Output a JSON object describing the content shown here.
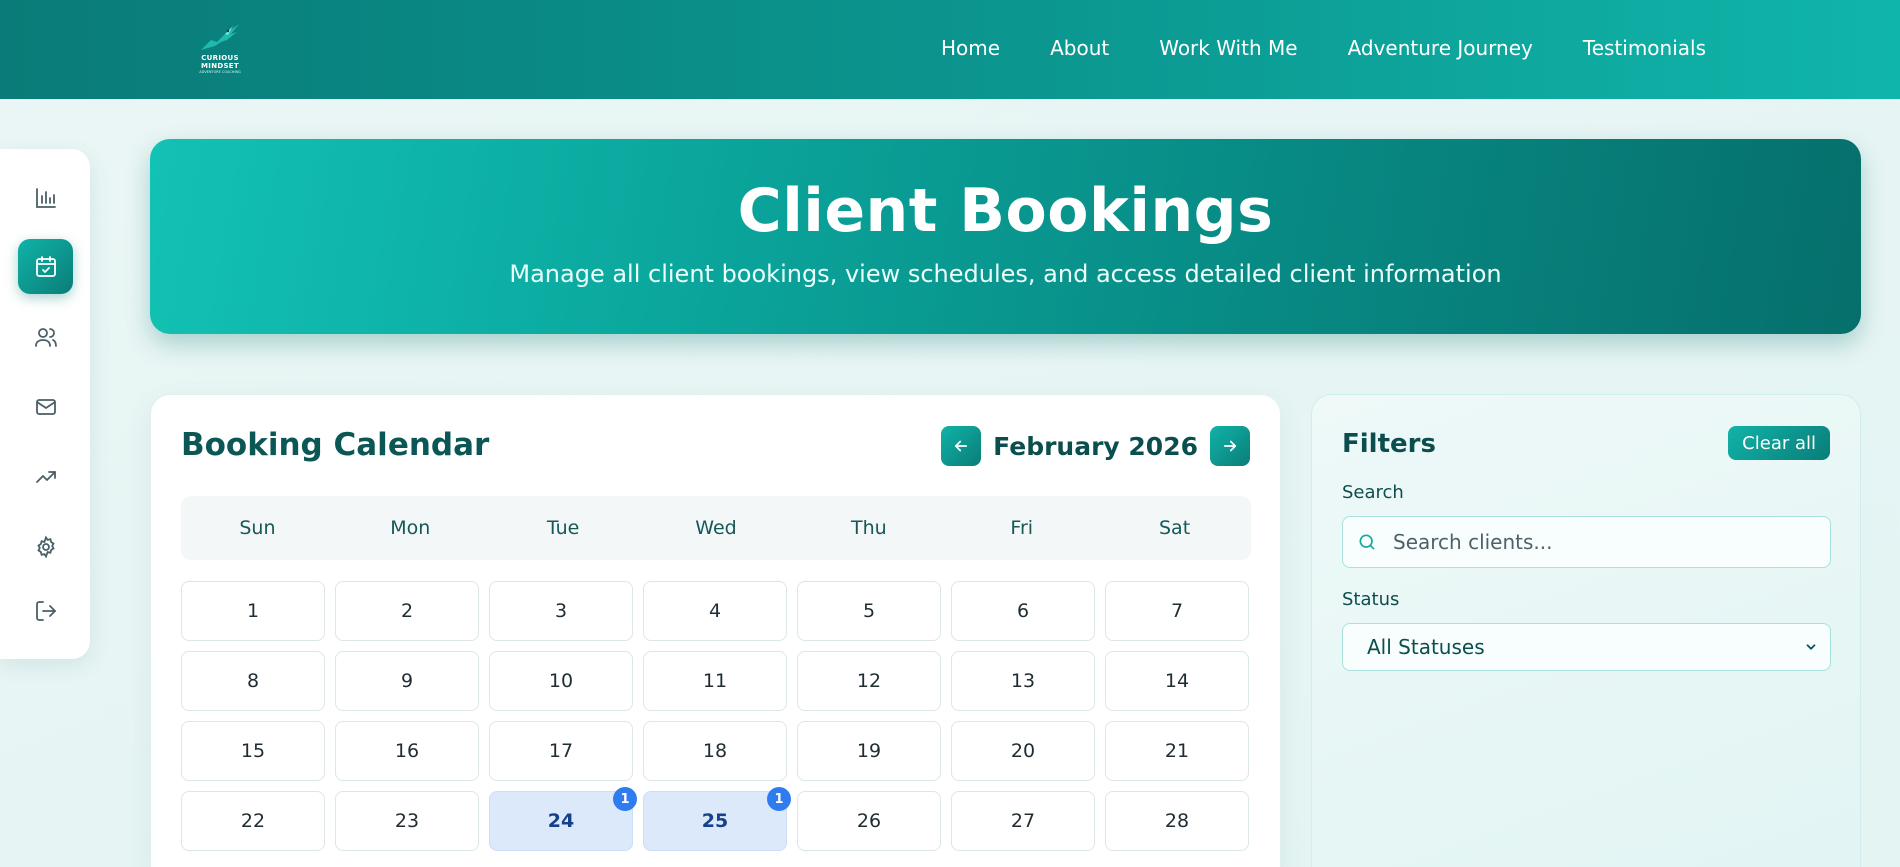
{
  "brand": {
    "logo_line1": "CURIOUS",
    "logo_line2": "MINDSET",
    "logo_tagline": "ADVENTURE COACHING"
  },
  "nav": {
    "items": [
      {
        "label": "Home"
      },
      {
        "label": "About"
      },
      {
        "label": "Work With Me"
      },
      {
        "label": "Adventure Journey"
      },
      {
        "label": "Testimonials"
      }
    ]
  },
  "sidebar": {
    "items": [
      {
        "icon": "bar-chart-icon",
        "active": false
      },
      {
        "icon": "calendar-check-icon",
        "active": true
      },
      {
        "icon": "users-icon",
        "active": false
      },
      {
        "icon": "mail-icon",
        "active": false
      },
      {
        "icon": "trending-up-icon",
        "active": false
      },
      {
        "icon": "gear-icon",
        "active": false
      },
      {
        "icon": "logout-icon",
        "active": false
      }
    ]
  },
  "hero": {
    "title": "Client Bookings",
    "subtitle": "Manage all client bookings, view schedules, and access detailed client information"
  },
  "calendar": {
    "title": "Booking Calendar",
    "month_label": "February 2026",
    "weekdays": [
      "Sun",
      "Mon",
      "Tue",
      "Wed",
      "Thu",
      "Fri",
      "Sat"
    ],
    "days": [
      {
        "day": "1"
      },
      {
        "day": "2"
      },
      {
        "day": "3"
      },
      {
        "day": "4"
      },
      {
        "day": "5"
      },
      {
        "day": "6"
      },
      {
        "day": "7"
      },
      {
        "day": "8"
      },
      {
        "day": "9"
      },
      {
        "day": "10"
      },
      {
        "day": "11"
      },
      {
        "day": "12"
      },
      {
        "day": "13"
      },
      {
        "day": "14"
      },
      {
        "day": "15"
      },
      {
        "day": "16"
      },
      {
        "day": "17"
      },
      {
        "day": "18"
      },
      {
        "day": "19"
      },
      {
        "day": "20"
      },
      {
        "day": "21"
      },
      {
        "day": "22"
      },
      {
        "day": "23"
      },
      {
        "day": "24",
        "bookings": "1"
      },
      {
        "day": "25",
        "bookings": "1"
      },
      {
        "day": "26"
      },
      {
        "day": "27"
      },
      {
        "day": "28"
      }
    ]
  },
  "filters": {
    "title": "Filters",
    "clear_label": "Clear all",
    "search_label": "Search",
    "search_placeholder": "Search clients...",
    "status_label": "Status",
    "status_value": "All Statuses"
  },
  "colors": {
    "accent": "#0a8d87",
    "accent_light": "#12c2b4",
    "booked_day_bg": "#dce9fb",
    "badge": "#2f7cf0"
  }
}
